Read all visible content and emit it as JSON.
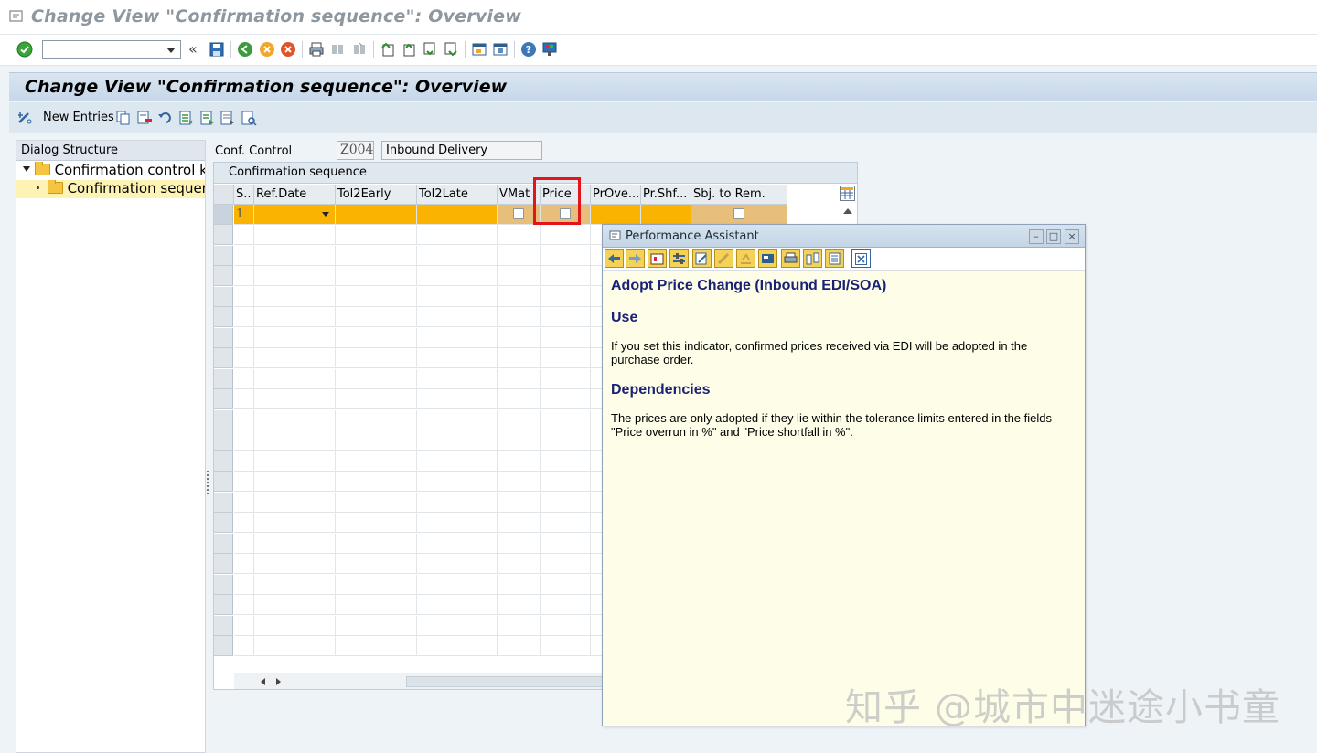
{
  "window": {
    "title": "Change View \"Confirmation sequence\": Overview"
  },
  "screen_header": {
    "title": "Change View \"Confirmation sequence\": Overview"
  },
  "app_toolbar": {
    "new_entries_label": "New Entries"
  },
  "dialog_structure": {
    "header": "Dialog Structure",
    "items": [
      {
        "label": "Confirmation control key"
      },
      {
        "label": "Confirmation sequence"
      }
    ]
  },
  "conf_control": {
    "label": "Conf. Control",
    "key": "Z004",
    "description": "Inbound Delivery"
  },
  "table": {
    "title": "Confirmation sequence",
    "columns": [
      "S..",
      "Ref.Date",
      "Tol2Early",
      "Tol2Late",
      "VMat",
      "Price",
      "PrOve...",
      "Pr.Shf...",
      "Sbj. to Rem."
    ],
    "rows": [
      {
        "seq": "1"
      }
    ]
  },
  "performance_assistant": {
    "title": "Performance Assistant",
    "heading": "Adopt Price Change (Inbound EDI/SOA)",
    "use_heading": "Use",
    "use_text": "If you set this indicator, confirmed prices received via EDI will be adopted in the purchase order.",
    "dependencies_heading": "Dependencies",
    "dependencies_text": "The prices are only adopted if they lie within the tolerance limits entered in the fields \"Price overrun in %\" and \"Price shortfall in %\"."
  },
  "watermark": "知乎 @城市中迷途小书童",
  "colors": {
    "selected_row": "#f9b300",
    "highlight_box": "#e3151a",
    "pa_background": "#fefde8",
    "pa_heading": "#1a2275"
  }
}
